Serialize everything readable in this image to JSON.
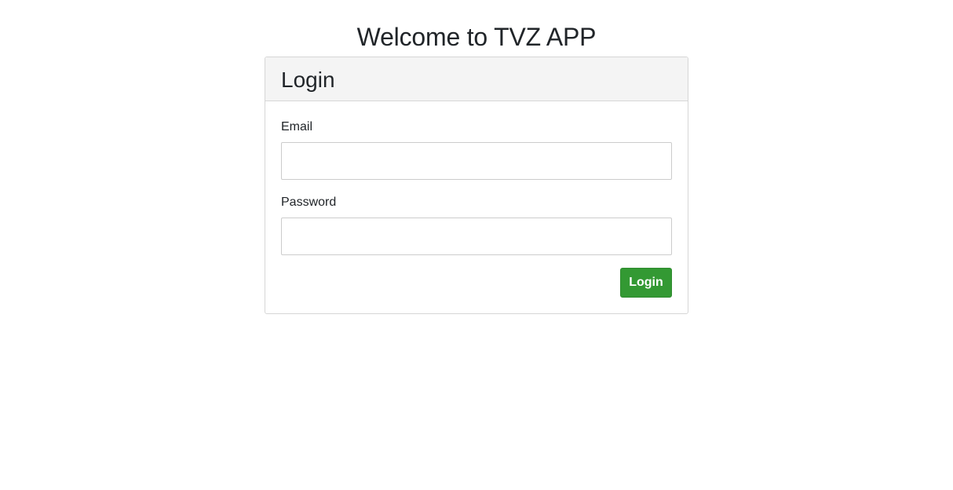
{
  "page": {
    "title": "Welcome to TVZ APP"
  },
  "login_card": {
    "title": "Login",
    "email": {
      "label": "Email",
      "value": "",
      "placeholder": ""
    },
    "password": {
      "label": "Password",
      "value": "",
      "placeholder": ""
    },
    "submit_label": "Login"
  },
  "colors": {
    "primary_button": "#339933",
    "card_header_bg": "#f4f4f4",
    "border": "#d6d6d6",
    "text": "#212529"
  }
}
